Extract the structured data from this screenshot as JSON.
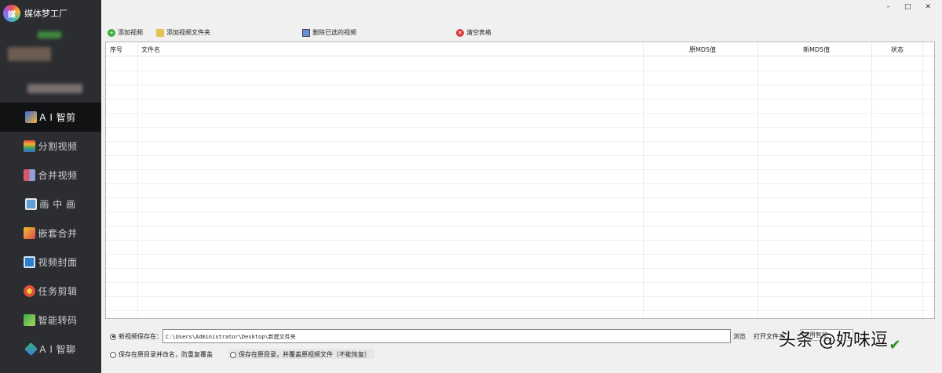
{
  "app": {
    "name": "媒体梦工厂"
  },
  "window_controls": {
    "minimize": "–",
    "maximize": "□",
    "close": "✕"
  },
  "sidebar": {
    "items": [
      {
        "label": "A I 智剪",
        "icon": "ai-edit-icon",
        "active": true
      },
      {
        "label": "分割视频",
        "icon": "split-video-icon"
      },
      {
        "label": "合并视频",
        "icon": "merge-video-icon"
      },
      {
        "label": "画 中 画",
        "icon": "picture-in-picture-icon"
      },
      {
        "label": "嵌套合并",
        "icon": "nested-merge-icon"
      },
      {
        "label": "视频封面",
        "icon": "video-cover-icon"
      },
      {
        "label": "任务剪辑",
        "icon": "task-edit-icon"
      },
      {
        "label": "智能转码",
        "icon": "transcode-icon"
      },
      {
        "label": "A I 智聊",
        "icon": "ai-chat-icon"
      }
    ]
  },
  "toolbar": {
    "add_video": "添加视频",
    "add_folder": "添加视频文件夹",
    "delete_selected": "删除已选的视频",
    "clear_table": "清空表格"
  },
  "table": {
    "columns": [
      "序号",
      "文件名",
      "原MD5值",
      "新MD5值",
      "状态"
    ],
    "rows": []
  },
  "save": {
    "new_location_label": "新视频保存在：",
    "path": "C:\\Users\\Administrator\\Desktop\\新建文件夹",
    "browse": "浏览",
    "open_folder": "打开文件夹",
    "option_rename": "保存在原目录并改名，防重复覆盖",
    "option_overwrite": "保存在原目录，并覆盖原视频文件（不能恢复）",
    "mode_select": "通用智能",
    "selected_option": "new_location"
  },
  "watermark": "头条 @奶味逗"
}
